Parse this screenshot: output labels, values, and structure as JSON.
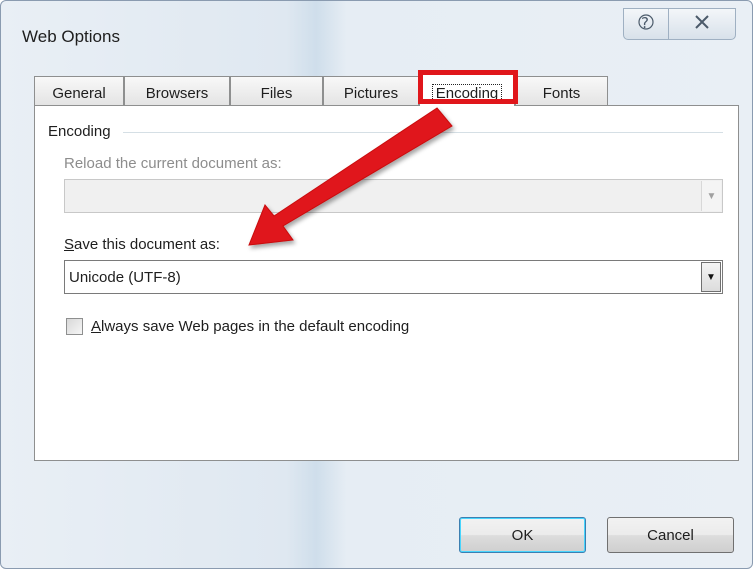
{
  "window": {
    "title": "Web Options"
  },
  "tabs": [
    {
      "label": "General"
    },
    {
      "label": "Browsers"
    },
    {
      "label": "Files"
    },
    {
      "label": "Pictures"
    },
    {
      "label": "Encoding"
    },
    {
      "label": "Fonts"
    }
  ],
  "active_tab": "Encoding",
  "encoding_group": {
    "label": "Encoding",
    "reload_label": "Reload the current document as:",
    "reload_value": "",
    "save_label_accel": "S",
    "save_label_rest": "ave this document as:",
    "save_value": "Unicode (UTF-8)",
    "always_save_accel": "A",
    "always_save_rest": "lways save Web pages in the default encoding",
    "always_save_checked": false
  },
  "buttons": {
    "ok": "OK",
    "cancel": "Cancel"
  },
  "icons": {
    "help": "help-icon",
    "close": "close-icon",
    "dropdown": "chevron-down-icon",
    "annotation": "red-arrow-annotation"
  },
  "colors": {
    "highlight": "#e0161b",
    "dialog_bg": "#e9eff5",
    "panel_bg": "#ffffff"
  }
}
